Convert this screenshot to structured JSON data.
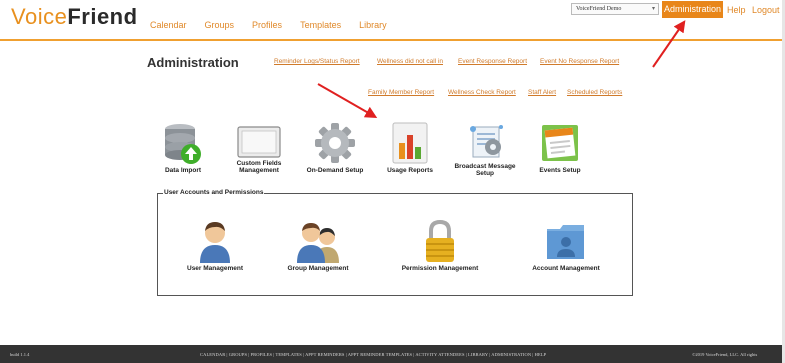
{
  "logo": {
    "voice": "Voice",
    "friend": "Friend"
  },
  "nav": [
    "Calendar",
    "Groups",
    "Profiles",
    "Templates",
    "Library"
  ],
  "account_select": {
    "value": "VoiceFriend Demo"
  },
  "top_links": {
    "administration": "Administration",
    "help": "Help",
    "logout": "Logout"
  },
  "page_title": "Administration",
  "reports_row1": [
    "Reminder Logs/Status Report",
    "Wellness did not call in",
    "Event Response Report",
    "Event No Response Report"
  ],
  "reports_row2": [
    "Family Member Report",
    "Wellness Check Report",
    "Staff Alert",
    "Scheduled Reports"
  ],
  "tools": [
    {
      "label": "Data Import",
      "icon": "database-import-icon"
    },
    {
      "label": "Custom Fields Management",
      "icon": "custom-fields-icon"
    },
    {
      "label": "On-Demand Setup",
      "icon": "gear-icon"
    },
    {
      "label": "Usage Reports",
      "icon": "bar-chart-icon"
    },
    {
      "label": "Broadcast Message Setup",
      "icon": "broadcast-icon"
    },
    {
      "label": "Events Setup",
      "icon": "calendar-event-icon"
    }
  ],
  "user_section": {
    "title": "User Accounts and Permissions",
    "items": [
      {
        "label": "User Management",
        "icon": "user-icon"
      },
      {
        "label": "Group Management",
        "icon": "group-icon"
      },
      {
        "label": "Permission Management",
        "icon": "padlock-icon"
      },
      {
        "label": "Account Management",
        "icon": "folder-user-icon"
      }
    ]
  },
  "footer": {
    "build": "build 1.1.4",
    "links": "CALENDAR | GROUPS | PROFILES | TEMPLATES | APPT REMINDERS | APPT REMINDER TEMPLATES | ACTIVITY ATTENDEES | LIBRARY | ADMINISTRATION | HELP",
    "copyright": "©2019 VoiceFriend, LLC. All rights"
  },
  "colors": {
    "accent": "#e8861a",
    "link": "#d07a2a",
    "footer_bg": "#333333",
    "annotation_arrow": "#e02020"
  }
}
